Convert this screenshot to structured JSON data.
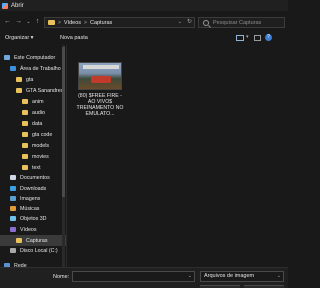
{
  "window": {
    "title": "Abrir"
  },
  "address": {
    "crumbs": [
      "Vídeos",
      "Capturas"
    ],
    "separator": ">"
  },
  "search": {
    "placeholder": "Pesquisar Capturas"
  },
  "toolbar": {
    "organize_label": "Organizar ▾",
    "new_folder_label": "Nova pasta"
  },
  "nav": {
    "items": [
      {
        "label": "Este Computador",
        "icon": "computer-icon",
        "indent": 0
      },
      {
        "label": "Área de Trabalho",
        "icon": "desktop-icon",
        "indent": 1
      },
      {
        "label": "gta",
        "icon": "folder-icon",
        "indent": 2
      },
      {
        "label": "GTA Sanandres",
        "icon": "folder-icon",
        "indent": 2
      },
      {
        "label": "anim",
        "icon": "folder-icon",
        "indent": 3
      },
      {
        "label": "audio",
        "icon": "folder-icon",
        "indent": 3
      },
      {
        "label": "data",
        "icon": "folder-icon",
        "indent": 3
      },
      {
        "label": "gta code",
        "icon": "folder-icon",
        "indent": 3
      },
      {
        "label": "models",
        "icon": "folder-icon",
        "indent": 3
      },
      {
        "label": "movies",
        "icon": "folder-icon",
        "indent": 3
      },
      {
        "label": "text",
        "icon": "folder-icon",
        "indent": 3
      },
      {
        "label": "Documentos",
        "icon": "documents-icon",
        "indent": 1
      },
      {
        "label": "Downloads",
        "icon": "downloads-icon",
        "indent": 1
      },
      {
        "label": "Imagens",
        "icon": "images-icon",
        "indent": 1
      },
      {
        "label": "Músicas",
        "icon": "music-icon",
        "indent": 1
      },
      {
        "label": "Objetos 3D",
        "icon": "objects-3d-icon",
        "indent": 1
      },
      {
        "label": "Vídeos",
        "icon": "videos-icon",
        "indent": 1
      },
      {
        "label": "Capturas",
        "icon": "folder-icon",
        "indent": 2,
        "selected": true
      },
      {
        "label": "Disco Local (C:)",
        "icon": "disk-icon",
        "indent": 1
      },
      {
        "label": "Rede",
        "icon": "network-icon",
        "indent": 0
      }
    ]
  },
  "files": [
    {
      "name": "(80) $FREE FIRE - AO VIVO$ TREINAMENTO NO EMULATO..."
    }
  ],
  "bottom": {
    "name_label": "Nome:",
    "name_value": "",
    "filter_value": "Arquivos de imagem"
  }
}
